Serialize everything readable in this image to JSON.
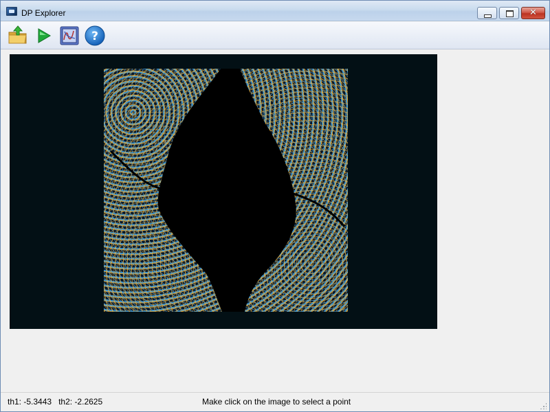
{
  "window": {
    "title": "DP Explorer"
  },
  "toolbar": {
    "buttons": [
      {
        "name": "open",
        "icon": "folder-open-icon"
      },
      {
        "name": "run",
        "icon": "play-icon"
      },
      {
        "name": "image",
        "icon": "image-view-icon"
      },
      {
        "name": "help",
        "icon": "help-icon",
        "glyph": "?"
      }
    ]
  },
  "canvas": {
    "background": "#031015",
    "image_colors": [
      "#3b8ec4",
      "#d79a2a",
      "#000000"
    ]
  },
  "status": {
    "th1_label": "th1:",
    "th1_value": "-5.3443",
    "th2_label": "th2:",
    "th2_value": "-2.2625",
    "message": "Make click on the image to select a point"
  }
}
